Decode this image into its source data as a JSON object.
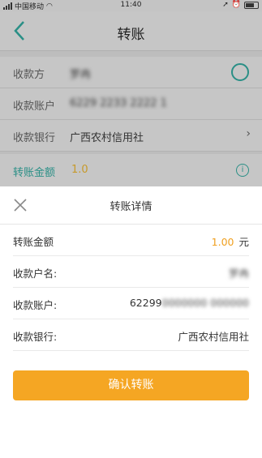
{
  "status_bar": {
    "carrier": "中国移动",
    "time": "11:40"
  },
  "nav": {
    "title": "转账"
  },
  "background_form": {
    "rows": [
      {
        "label": "收款方",
        "value": "罗冉"
      },
      {
        "label": "收款账户",
        "value": "6229 2233 2222 1"
      },
      {
        "label": "收款银行",
        "value": "广西农村信用社"
      }
    ],
    "amount_label": "转账金额",
    "amount_value": "1.0"
  },
  "sheet": {
    "title": "转账详情",
    "rows": [
      {
        "label": "转账金额",
        "value": "1.00",
        "unit": "元"
      },
      {
        "label": "收款户名:",
        "value": "罗冉"
      },
      {
        "label": "收款账户:",
        "value_prefix": "62299",
        "value_hidden": "0000000 000000"
      },
      {
        "label": "收款银行:",
        "value": "广西农村信用社"
      }
    ],
    "confirm_label": "确认转账"
  },
  "colors": {
    "accent_green": "#2a8f86",
    "accent_orange": "#f5a623"
  }
}
